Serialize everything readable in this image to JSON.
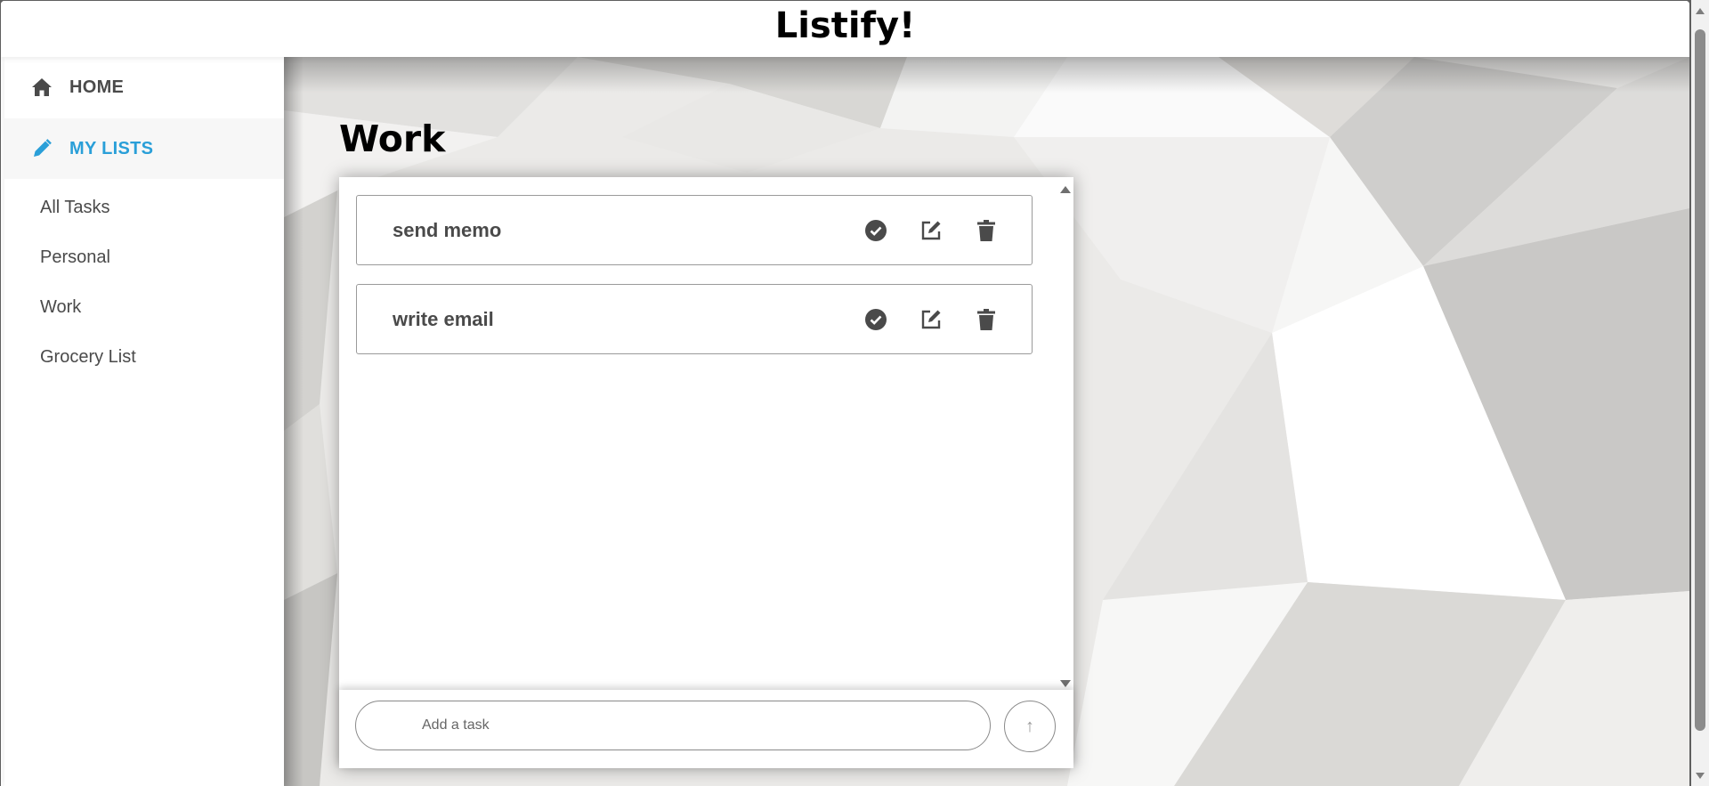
{
  "app": {
    "title": "Listify!"
  },
  "nav": {
    "home": {
      "label": "HOME",
      "icon": "home-icon"
    },
    "my_lists": {
      "label": "MY LISTS",
      "icon": "pencil-icon",
      "active": true
    },
    "lists": [
      "All Tasks",
      "Personal",
      "Work",
      "Grocery List"
    ]
  },
  "list": {
    "title": "Work",
    "tasks": [
      {
        "text": "send memo"
      },
      {
        "text": "write email"
      }
    ]
  },
  "composer": {
    "placeholder": "Add a task",
    "submit_label": "↑"
  },
  "colors": {
    "accent": "#2a9fd8",
    "text": "#4a4a4a",
    "active_nav_bg": "#f7f7f7"
  }
}
